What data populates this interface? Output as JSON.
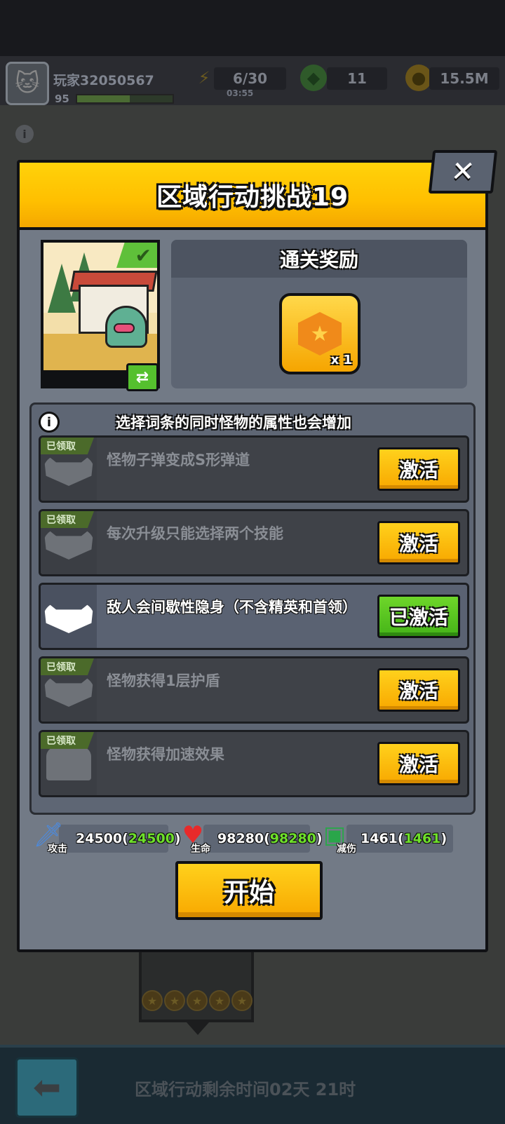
{
  "hud": {
    "player_name": "玩家32050567",
    "player_level": "95",
    "xp_fraction": 0.55,
    "energy": "6/30",
    "energy_timer": "03:55",
    "gems": "11",
    "coins": "15.5M"
  },
  "modal": {
    "title": "区域行动挑战19",
    "close_symbol": "✕",
    "reward_title": "通关奖励",
    "reward_qty": "x 1",
    "hint": "选择词条的同时怪物的属性也会增加",
    "modifiers": [
      {
        "text": "怪物子弹变成S形弹道",
        "tag": "已领取",
        "button": "激活",
        "active": false,
        "icon": "mask-icon"
      },
      {
        "text": "每次升级只能选择两个技能",
        "tag": "已领取",
        "button": "激活",
        "active": false,
        "icon": "mask-icon"
      },
      {
        "text": "敌人会间歇性隐身（不含精英和首领）",
        "tag": "",
        "button": "已激活",
        "active": true,
        "icon": "mask-icon"
      },
      {
        "text": "怪物获得1层护盾",
        "tag": "已领取",
        "button": "激活",
        "active": false,
        "icon": "mask-icon"
      },
      {
        "text": "怪物获得加速效果",
        "tag": "已领取",
        "button": "激活",
        "active": false,
        "icon": "ghost-speed-icon"
      }
    ],
    "stats": {
      "attack_label": "攻击",
      "attack_value": "24500(",
      "attack_base": "24500",
      "hp_label": "生命",
      "hp_value": "98280(",
      "hp_base": "98280",
      "def_label": "减伤",
      "def_value": "1461(",
      "def_base": "1461",
      "close_paren": ")"
    },
    "start_label": "开始"
  },
  "background": {
    "remaining_time": "区域行动剩余时间02天 21时"
  },
  "colors": {
    "header_yellow": "#ffbf00",
    "button_yellow": "#f8a800",
    "active_green": "#45b418",
    "stat_green": "#6ee02a"
  }
}
